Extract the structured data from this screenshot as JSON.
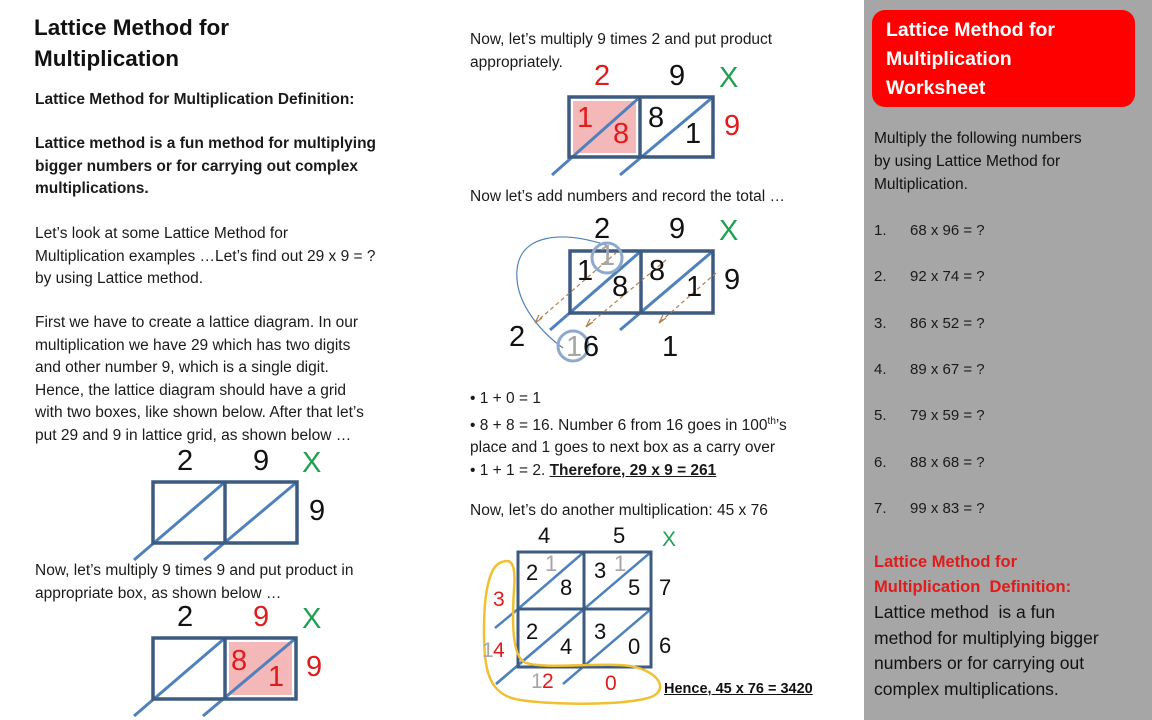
{
  "left": {
    "title_line1": "Lattice Method for",
    "title_line2": "Multiplication",
    "definition_heading": "Lattice Method for Multiplication Definition:",
    "definition_body": [
      "Lattice method is a fun method for multiplying",
      "bigger numbers or for carrying out complex",
      "multiplications."
    ],
    "intro": [
      "Let’s look at some Lattice Method for",
      "Multiplication examples …Let’s find out 29 x 9 = ?",
      "by using Lattice method."
    ],
    "step1": [
      "First we have to create a lattice diagram. In our",
      "multiplication we have 29 which has two digits",
      "and other number 9, which is a single digit.",
      "Hence, the lattice diagram should have a grid",
      "with two boxes, like shown below. After that let’s",
      "put 29 and 9 in lattice grid, as shown below …"
    ],
    "step2": [
      "Now, let’s multiply 9 times 9 and put product in",
      "appropriate box, as shown below …"
    ]
  },
  "middle": {
    "step3": [
      "Now, let’s multiply 9 times 2 and put product",
      "appropriately."
    ],
    "step4": "Now let’s add numbers and record the total …",
    "bullets": [
      {
        "bullet": "•",
        "text": "1 + 0 = 1"
      },
      {
        "bullet": "•",
        "text": "8 + 8 = 16. Number 6 from 16 goes in 100",
        "sup": "th",
        "after": "’s"
      },
      {
        "bullet": "",
        "text": "place and 1 goes to next box as a carry over"
      },
      {
        "bullet": "•",
        "text": "1 + 1 = 2. ",
        "emph": "Therefore, 29 x 9 = 261"
      }
    ],
    "step5": "Now, let’s do another multiplication: 45 x 76",
    "result": "Hence, 45 x 76 = 3420"
  },
  "diagrams": {
    "times_symbol": "X",
    "d1": {
      "top": [
        "2",
        "9"
      ],
      "side": "9"
    },
    "d2": {
      "top": [
        "2",
        "9"
      ],
      "side": "9",
      "cell2": [
        "8",
        "1"
      ]
    },
    "d3": {
      "top": [
        "2",
        "9"
      ],
      "side": "9",
      "cell1": [
        "1",
        "8"
      ],
      "cell2": [
        "8",
        "1"
      ]
    },
    "d4": {
      "top": [
        "2",
        "9"
      ],
      "side": "9",
      "cell1": [
        "1",
        "8"
      ],
      "cell2": [
        "8",
        "1"
      ],
      "carry": "1",
      "bottom": [
        "2",
        "1",
        "6",
        "1"
      ]
    },
    "d5": {
      "top": [
        "4",
        "5"
      ],
      "side": [
        "7",
        "6"
      ],
      "cells": [
        [
          "2",
          "8"
        ],
        [
          "3",
          "5"
        ],
        [
          "2",
          "4"
        ],
        [
          "3",
          "0"
        ]
      ],
      "carries": [
        "1",
        "1"
      ],
      "left": [
        "3",
        "1",
        "4"
      ],
      "bottom": [
        "1",
        "2",
        "0"
      ]
    }
  },
  "panel": {
    "heading_lines": [
      "Lattice Method for",
      "Multiplication",
      "Worksheet"
    ],
    "intro": [
      "Multiply the following numbers",
      "by using Lattice Method for",
      "Multiplication."
    ],
    "problems": [
      {
        "num": "1.",
        "text": "68 x 96 = ?"
      },
      {
        "num": "2.",
        "text": "92 x 74 = ?"
      },
      {
        "num": "3.",
        "text": "86 x 52 = ?"
      },
      {
        "num": "4.",
        "text": "89 x 67 = ?"
      },
      {
        "num": "5.",
        "text": "79 x 59 = ?"
      },
      {
        "num": "6.",
        "text": "88 x 68 = ?"
      },
      {
        "num": "7.",
        "text": "99 x 83 = ?"
      }
    ],
    "def_title_lines": [
      "Lattice Method for",
      "Multiplication  Definition:"
    ],
    "def_body_lines": [
      "Lattice method  is a fun",
      "method for multiplying bigger",
      "numbers or for carrying out",
      "complex multiplications."
    ]
  },
  "colors": {
    "accent_red": "#ff0000",
    "text_red": "#e01b1b",
    "green": "#1fa050",
    "grid_stroke": "#3d5a80",
    "diag_stroke": "#4f81bd",
    "highlight": "#f5b8b8",
    "panel_gray": "#a6a6a6",
    "loop_yellow": "#f0c030"
  }
}
